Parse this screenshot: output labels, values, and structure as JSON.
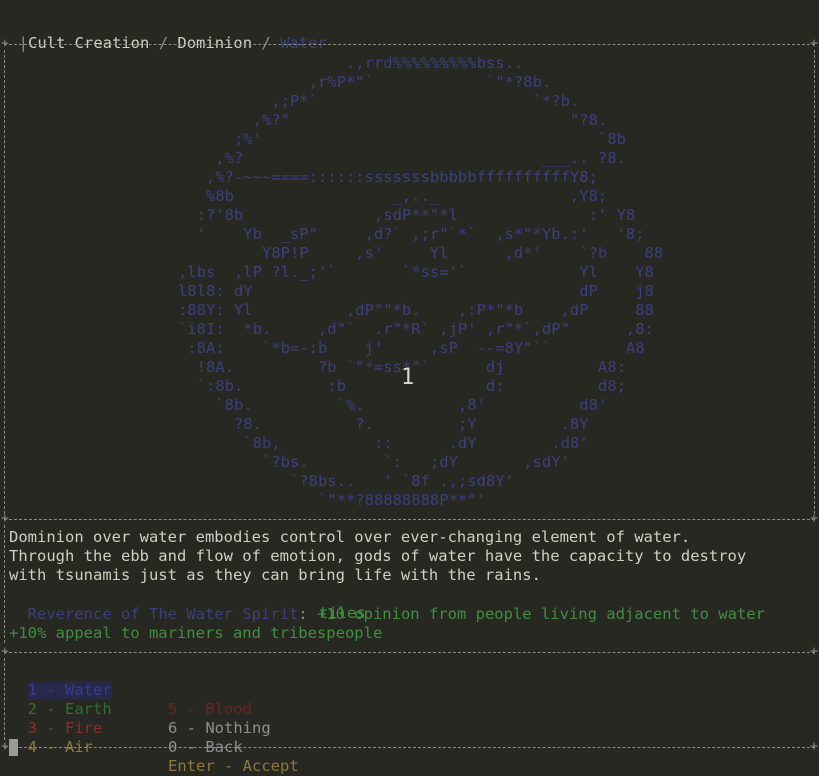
{
  "breadcrumb": {
    "items": [
      "Cult Creation",
      "Dominion"
    ],
    "separator": "/",
    "current": "Water"
  },
  "art": {
    "lines": [
      "                                    .,rrd%%%%%%%%%bss..",
      "                                ,r%P*\"`            `\"*?8b.",
      "                            ,;P*`                       `*?b.",
      "                          ,%?\"                              \"?8.",
      "                        ;%'                                    `8b",
      "                      ,%?                                ___.. ?8.",
      "                     ,%?-~~~====::::::sssssssbbbbbffffffffffY8;",
      "                     %8b                 _,.._              ,Y8;",
      "                    :?'8b              ,sdP**\"*l              :' Y8",
      "                    '    Yb  _sP\"     ,d?` ,;r\"`*`  ,s*\"*Yb.:'   '8;",
      "                           Y8P!P     ,s'     Yl      ,d*'    `?b    88",
      "                  ,lbs  ,lP ?l._;'`       `*ss='`            Yl    Y8",
      "                  l8l8: dY                                   dP    j8",
      "                  :88Y: Yl          ,dP\"\"*b.    ,:P*\"*b    ,dP     88",
      "                  `i8I:  *b.     ,d\"`  .r\"*R` ,jP' ,r\"*`,dP\"      ,8:",
      "                   :8A:    `*b=-:b    j'     ,sP  --=8Y\"``        A8",
      "                    !8A.         ?b `\"*=ss*\"`      dj          A8:",
      "                    `:8b.         :b               d:          d8;",
      "                      `8b.         `%.          ,8'          d8'",
      "                        ?8.          ?.         ;Y         .8Y",
      "                         `8b,          ::      .dY        .d8'",
      "                           `?bs.        `:   ;dY       ,sdY'",
      "                              `?8bs..   ' `8f .,;sd8Y'",
      "                                 `\"**?88888888P**\"'"
    ],
    "center_number": "1"
  },
  "description": {
    "lines": [
      "Dominion over water embodies control over ever-changing element of water.",
      "Through the ebb and flow of emotion, gods of water have the capacity to destroy",
      "with tsunamis just as they can bring life with the rains."
    ],
    "trait_name": "Reverence of The Water Spirit",
    "trait_separator": ":",
    "trait_effect_line1": "+10 opinion from people living adjacent to water",
    "trait_effect_line2": "tiles",
    "bonus": "+10% appeal to mariners and tribespeople"
  },
  "menu": {
    "left": [
      {
        "key": "1",
        "label": "Water",
        "color": "#3a3c8a",
        "selected": true
      },
      {
        "key": "2",
        "label": "Earth",
        "color": "#2f6f2f"
      },
      {
        "key": "3",
        "label": "Fire",
        "color": "#8a3030"
      },
      {
        "key": "4",
        "label": "Air",
        "color": "#8a7a40"
      }
    ],
    "right": [
      {
        "key": "5",
        "label": "Blood",
        "color": "#6a2424"
      },
      {
        "key": "6",
        "label": "Nothing",
        "color": "#8f8f8f"
      },
      {
        "key": "0",
        "label": "Back",
        "color": "#8f8f8f"
      },
      {
        "key": "Enter",
        "label": "Accept",
        "color": "#8a7a40"
      }
    ],
    "dash": " - "
  },
  "colors": {
    "background": "#272822",
    "water": "#3d3f7e",
    "positive": "#3f8f3f",
    "border": "#8a8a8a"
  }
}
